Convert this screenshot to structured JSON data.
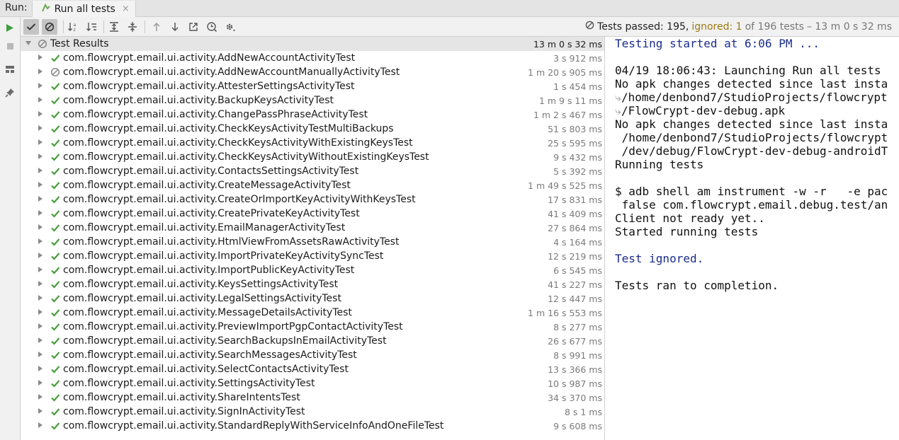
{
  "titlebar": {
    "run_label": "Run:",
    "tab_title": "Run all tests",
    "tab_close": "×"
  },
  "toolbar": {
    "status_passed": "Tests passed: 195,",
    "status_ignored": "ignored: 1",
    "status_of": "of 196 tests",
    "status_duration": "– 13 m 0 s 32 ms"
  },
  "tree": {
    "root": {
      "label": "Test Results",
      "duration": "13 m 0 s 32 ms",
      "status": "ignored"
    },
    "rows": [
      {
        "label": "com.flowcrypt.email.ui.activity.AddNewAccountActivityTest",
        "duration": "3 s 912 ms",
        "status": "passed"
      },
      {
        "label": "com.flowcrypt.email.ui.activity.AddNewAccountManuallyActivityTest",
        "duration": "1 m 20 s 905 ms",
        "status": "ignored"
      },
      {
        "label": "com.flowcrypt.email.ui.activity.AttesterSettingsActivityTest",
        "duration": "1 s 454 ms",
        "status": "passed"
      },
      {
        "label": "com.flowcrypt.email.ui.activity.BackupKeysActivityTest",
        "duration": "1 m 9 s 11 ms",
        "status": "passed"
      },
      {
        "label": "com.flowcrypt.email.ui.activity.ChangePassPhraseActivityTest",
        "duration": "1 m 2 s 467 ms",
        "status": "passed"
      },
      {
        "label": "com.flowcrypt.email.ui.activity.CheckKeysActivityTestMultiBackups",
        "duration": "51 s 803 ms",
        "status": "passed"
      },
      {
        "label": "com.flowcrypt.email.ui.activity.CheckKeysActivityWithExistingKeysTest",
        "duration": "25 s 595 ms",
        "status": "passed"
      },
      {
        "label": "com.flowcrypt.email.ui.activity.CheckKeysActivityWithoutExistingKeysTest",
        "duration": "9 s 432 ms",
        "status": "passed"
      },
      {
        "label": "com.flowcrypt.email.ui.activity.ContactsSettingsActivityTest",
        "duration": "5 s 392 ms",
        "status": "passed"
      },
      {
        "label": "com.flowcrypt.email.ui.activity.CreateMessageActivityTest",
        "duration": "1 m 49 s 525 ms",
        "status": "passed"
      },
      {
        "label": "com.flowcrypt.email.ui.activity.CreateOrImportKeyActivityWithKeysTest",
        "duration": "17 s 831 ms",
        "status": "passed"
      },
      {
        "label": "com.flowcrypt.email.ui.activity.CreatePrivateKeyActivityTest",
        "duration": "41 s 409 ms",
        "status": "passed"
      },
      {
        "label": "com.flowcrypt.email.ui.activity.EmailManagerActivityTest",
        "duration": "27 s 864 ms",
        "status": "passed"
      },
      {
        "label": "com.flowcrypt.email.ui.activity.HtmlViewFromAssetsRawActivityTest",
        "duration": "4 s 164 ms",
        "status": "passed"
      },
      {
        "label": "com.flowcrypt.email.ui.activity.ImportPrivateKeyActivitySyncTest",
        "duration": "12 s 219 ms",
        "status": "passed"
      },
      {
        "label": "com.flowcrypt.email.ui.activity.ImportPublicKeyActivityTest",
        "duration": "6 s 545 ms",
        "status": "passed"
      },
      {
        "label": "com.flowcrypt.email.ui.activity.KeysSettingsActivityTest",
        "duration": "41 s 227 ms",
        "status": "passed"
      },
      {
        "label": "com.flowcrypt.email.ui.activity.LegalSettingsActivityTest",
        "duration": "12 s 447 ms",
        "status": "passed"
      },
      {
        "label": "com.flowcrypt.email.ui.activity.MessageDetailsActivityTest",
        "duration": "1 m 16 s 553 ms",
        "status": "passed"
      },
      {
        "label": "com.flowcrypt.email.ui.activity.PreviewImportPgpContactActivityTest",
        "duration": "8 s 277 ms",
        "status": "passed"
      },
      {
        "label": "com.flowcrypt.email.ui.activity.SearchBackupsInEmailActivityTest",
        "duration": "26 s 677 ms",
        "status": "passed"
      },
      {
        "label": "com.flowcrypt.email.ui.activity.SearchMessagesActivityTest",
        "duration": "8 s 991 ms",
        "status": "passed"
      },
      {
        "label": "com.flowcrypt.email.ui.activity.SelectContactsActivityTest",
        "duration": "13 s 366 ms",
        "status": "passed"
      },
      {
        "label": "com.flowcrypt.email.ui.activity.SettingsActivityTest",
        "duration": "10 s 987 ms",
        "status": "passed"
      },
      {
        "label": "com.flowcrypt.email.ui.activity.ShareIntentsTest",
        "duration": "34 s 370 ms",
        "status": "passed"
      },
      {
        "label": "com.flowcrypt.email.ui.activity.SignInActivityTest",
        "duration": "8 s 1 ms",
        "status": "passed"
      },
      {
        "label": "com.flowcrypt.email.ui.activity.StandardReplyWithServiceInfoAndOneFileTest",
        "duration": "9 s 608 ms",
        "status": "passed"
      }
    ]
  },
  "console": {
    "line_01": "Testing started at 6:06 PM ...",
    "line_02": "04/19 18:06:43: Launching Run all tests",
    "line_03": "No apk changes detected since last insta",
    "line_04": "/home/denbond7/StudioProjects/flowcrypt",
    "line_05": "/FlowCrypt-dev-debug.apk",
    "line_06": "No apk changes detected since last insta",
    "line_07": " /home/denbond7/StudioProjects/flowcrypt",
    "line_08": " /dev/debug/FlowCrypt-dev-debug-androidT",
    "line_09": "Running tests",
    "line_10": "$ adb shell am instrument -w -r   -e pac",
    "line_11": " false com.flowcrypt.email.debug.test/an",
    "line_12": "Client not ready yet..",
    "line_13": "Started running tests",
    "line_14": "Test ignored.",
    "line_15": "Tests ran to completion."
  },
  "colors": {
    "passed": "#4a9c3e",
    "ignored": "#8a8a8a",
    "run_green": "#3f9f3f",
    "console_blue": "#1a2c8c"
  },
  "icons": {
    "toolbar": [
      "check-icon",
      "ignored-filter-icon",
      "sort-alpha-icon",
      "sort-duration-icon",
      "expand-all-icon",
      "collapse-all-icon",
      "prev-failed-icon",
      "next-failed-icon",
      "export-icon",
      "history-icon",
      "settings-icon"
    ],
    "left": [
      "run-icon",
      "stop-icon",
      "layout-icon",
      "pin-icon"
    ]
  }
}
